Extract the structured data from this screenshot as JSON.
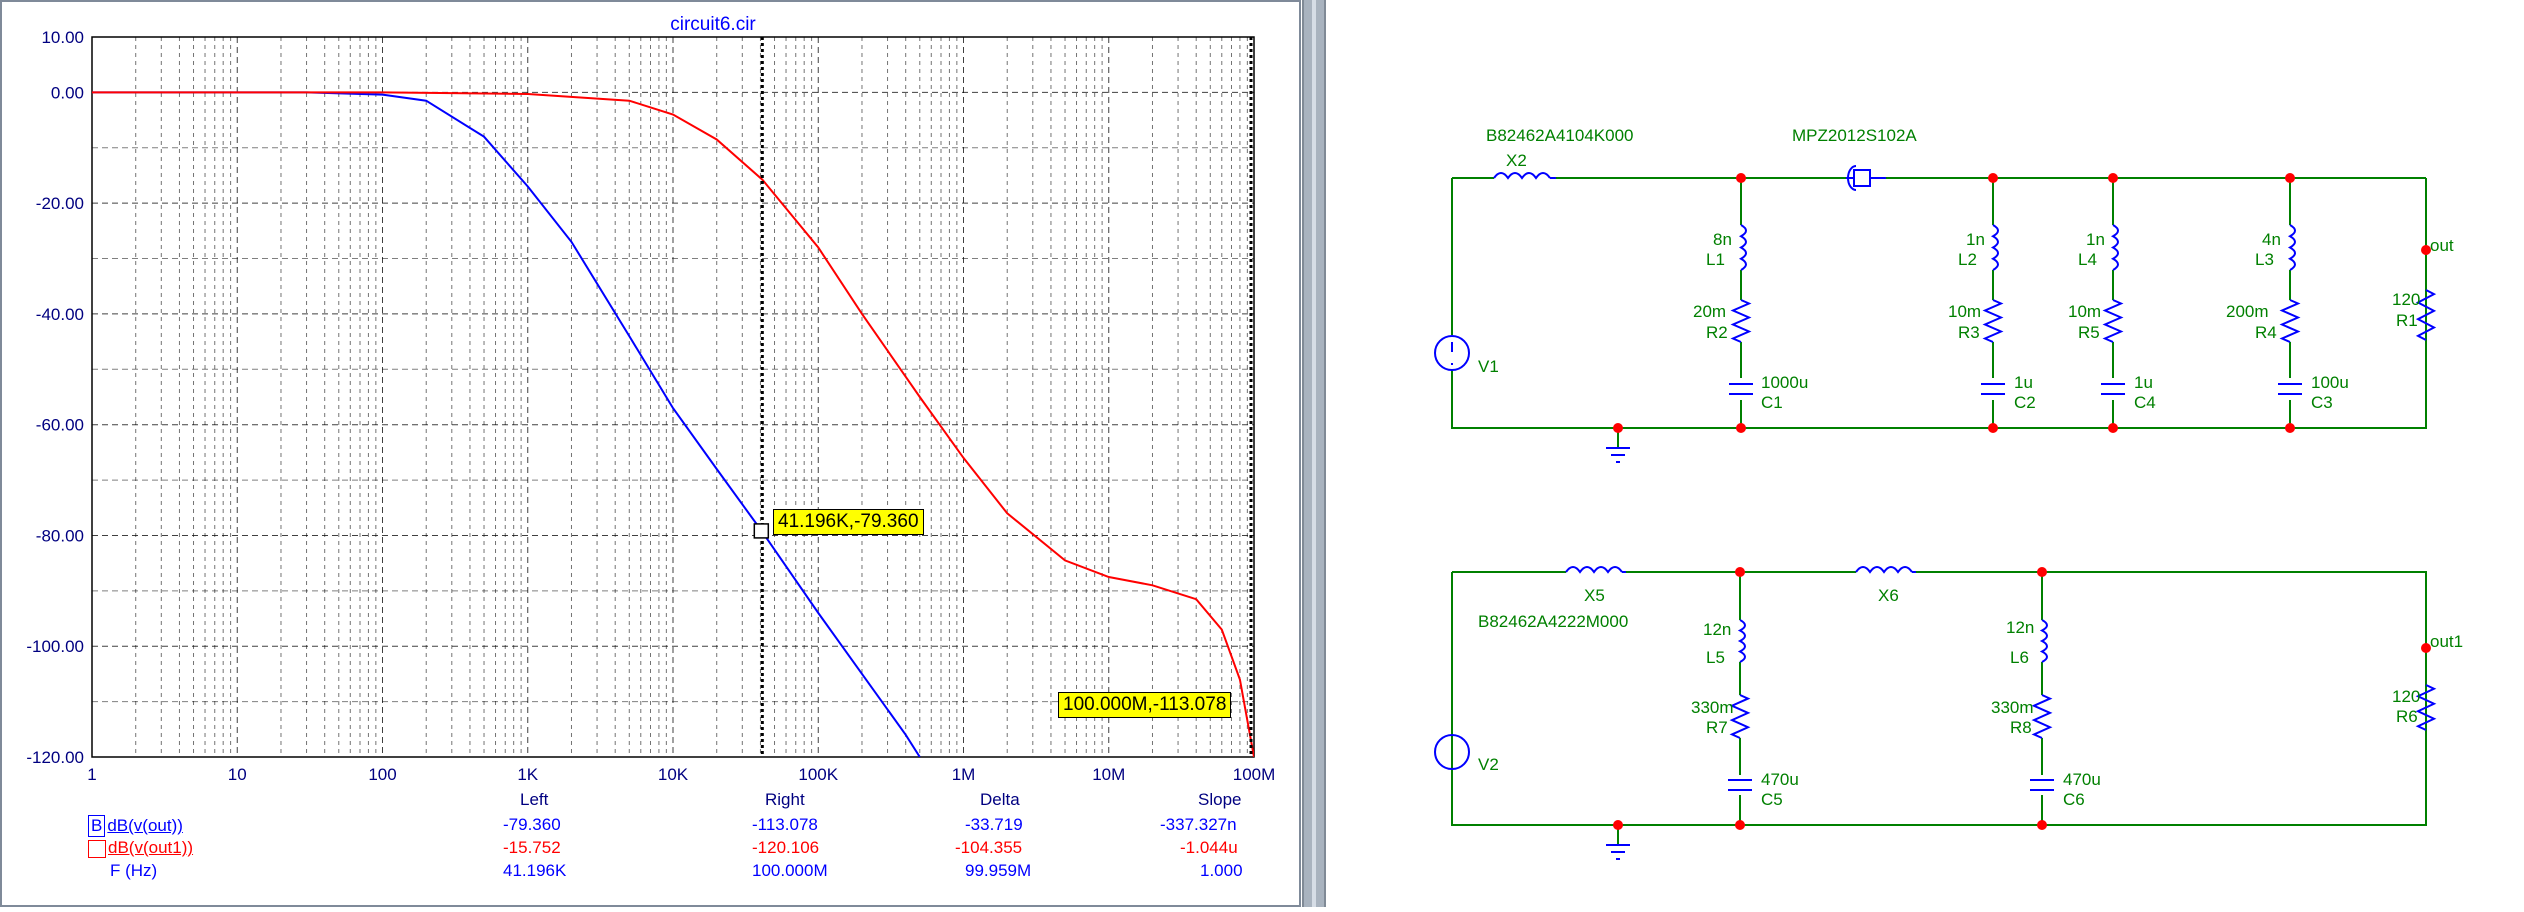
{
  "plot": {
    "title": "circuit6.cir",
    "cursor_labels": [
      "41.196K,-79.360",
      "100.000M,-113.078"
    ],
    "x_ticks": [
      "1",
      "10",
      "100",
      "1K",
      "10K",
      "100K",
      "1M",
      "10M",
      "100M"
    ],
    "y_ticks": [
      "10.00",
      "0.00",
      "-20.00",
      "-40.00",
      "-60.00",
      "-80.00",
      "-100.00",
      "-120.00"
    ]
  },
  "chart_data": {
    "type": "line",
    "title": "circuit6.cir",
    "x_scale": "log",
    "xlim": [
      1,
      100000000
    ],
    "ylim": [
      -120,
      10
    ],
    "grid": true,
    "series": [
      {
        "name": "dB(v(out))",
        "color": "#0000ff",
        "x": [
          1,
          10,
          30,
          100,
          200,
          500,
          1000,
          2000,
          5000,
          10000,
          20000,
          41196,
          100000,
          200000,
          400000,
          500000
        ],
        "y": [
          0,
          0,
          0,
          -0.4,
          -1.5,
          -8,
          -17,
          -27,
          -44,
          -57,
          -68,
          -79.36,
          -94,
          -105,
          -116,
          -120
        ]
      },
      {
        "name": "dB(v(out1))",
        "color": "#ff0000",
        "x": [
          1,
          100,
          1000,
          5000,
          10000,
          20000,
          41196,
          100000,
          200000,
          500000,
          1000000,
          2000000,
          5000000,
          10000000,
          20000000,
          40000000,
          60000000,
          80000000,
          100000000
        ],
        "y": [
          0,
          0,
          -0.3,
          -1.5,
          -4,
          -8.5,
          -15.75,
          -28,
          -40,
          -55,
          -66,
          -76,
          -84.5,
          -87.5,
          -89,
          -91.5,
          -97,
          -106,
          -120
        ]
      }
    ],
    "cursor": {
      "headers": [
        "Left",
        "Right",
        "Delta",
        "Slope"
      ],
      "rows": [
        {
          "label": "dB(v(out))",
          "marker": "B",
          "values": [
            "-79.360",
            "-113.078",
            "-33.719",
            "-337.327n"
          ]
        },
        {
          "label": "dB(v(out1))",
          "marker": "",
          "values": [
            "-15.752",
            "-120.106",
            "-104.355",
            "-1.044u"
          ]
        },
        {
          "label": "F (Hz)",
          "marker": "",
          "values": [
            "41.196K",
            "100.000M",
            "99.959M",
            "1.000"
          ]
        }
      ]
    }
  },
  "schematic": {
    "top": {
      "part_x2": "B82462A4104K000",
      "x2": "X2",
      "part_bead": "MPZ2012S102A",
      "v": "V1",
      "branches": [
        {
          "l_val": "8n",
          "l": "L1",
          "r_val": "20m",
          "r": "R2",
          "c_val": "1000u",
          "c": "C1"
        },
        {
          "l_val": "1n",
          "l": "L2",
          "r_val": "10m",
          "r": "R3",
          "c_val": "1u",
          "c": "C2"
        },
        {
          "l_val": "1n",
          "l": "L4",
          "r_val": "10m",
          "r": "R5",
          "c_val": "1u",
          "c": "C4"
        },
        {
          "l_val": "4n",
          "l": "L3",
          "r_val": "200m",
          "r": "R4",
          "c_val": "100u",
          "c": "C3"
        }
      ],
      "load_val": "120",
      "load": "R1",
      "node": "out"
    },
    "bottom": {
      "x5": "X5",
      "x6": "X6",
      "part_x5": "B82462A4222M000",
      "v": "V2",
      "branches": [
        {
          "l_val": "12n",
          "l": "L5",
          "r_val": "330m",
          "r": "R7",
          "c_val": "470u",
          "c": "C5"
        },
        {
          "l_val": "12n",
          "l": "L6",
          "r_val": "330m",
          "r": "R8",
          "c_val": "470u",
          "c": "C6"
        }
      ],
      "load_val": "120",
      "load": "R6",
      "node": "out1"
    }
  }
}
